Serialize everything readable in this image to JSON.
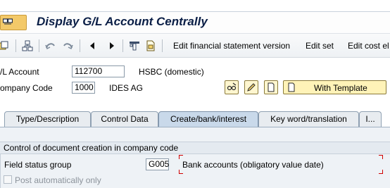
{
  "title": "Display G/L Account Centrally",
  "toolbar": {
    "edit_fsv_label": "Edit financial statement version",
    "edit_set_label": "Edit set",
    "edit_cost_label": "Edit cost el"
  },
  "form": {
    "gl_account_label": "/L Account",
    "gl_account_value": "112700",
    "gl_account_desc": "HSBC (domestic)",
    "company_code_label": "ompany Code",
    "company_code_value": "1000",
    "company_code_name": "IDES AG",
    "with_template_label": "With Template"
  },
  "tabs": [
    {
      "label": "Type/Description",
      "active": false
    },
    {
      "label": "Control Data",
      "active": false
    },
    {
      "label": "Create/bank/interest",
      "active": true
    },
    {
      "label": "Key word/translation",
      "active": false
    },
    {
      "label": "I...",
      "active": false
    }
  ],
  "group": {
    "title": "Control of document creation in company code",
    "field_status_group_label": "Field status group",
    "field_status_group_value": "G005",
    "field_status_group_text": "Bank accounts (obligatory value date)",
    "post_automatically_label": "Post automatically only",
    "post_automatically_checked": false
  },
  "colors": {
    "title_text": "#0a1e46",
    "active_tab": "#c9d9ea",
    "required_marker": "#d00000",
    "template_button": "#fff3b8"
  }
}
